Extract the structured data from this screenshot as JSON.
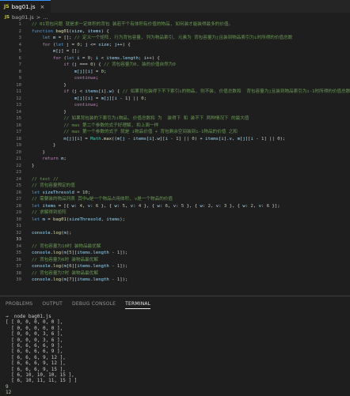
{
  "tab": {
    "icon": "JS",
    "label": "bag01.js",
    "close": "×"
  },
  "breadcrumb": {
    "icon": "JS",
    "file": "bag01.js",
    "separator": ">",
    "symbol": "..."
  },
  "colors": {
    "comment": "#6a9955",
    "keyword": "#569cd6",
    "control": "#c586c0",
    "function": "#dcdcaa",
    "variable": "#9cdcfe",
    "number": "#b5cea8",
    "string": "#ce9178",
    "plain": "#d4d4d4",
    "class": "#4ec9b0"
  },
  "code_lines": [
    {
      "n": "1",
      "tokens": [
        [
          "// 01背包问题 就是求一定体积的背包 装若干个有体积有价值的物品, 如何装才能装得最多的价值。",
          "comment"
        ]
      ]
    },
    {
      "n": "2",
      "tokens": [
        [
          "function ",
          "keyword"
        ],
        [
          "bag01",
          "function"
        ],
        [
          "(",
          "plain"
        ],
        [
          "size",
          "variable"
        ],
        [
          ", ",
          "plain"
        ],
        [
          "items",
          "variable"
        ],
        [
          ") {",
          "plain"
        ]
      ]
    },
    {
      "n": "3",
      "tokens": [
        [
          "    ",
          "plain"
        ],
        [
          "let ",
          "keyword"
        ],
        [
          "m",
          "variable"
        ],
        [
          " = []; ",
          "plain"
        ],
        [
          "// 定义一个矩阵, 行为背包容量, 列为物品索引, 元素为 背包容量为j且装到物品索引为i时所得的价值总数",
          "comment"
        ]
      ]
    },
    {
      "n": "4",
      "tokens": [
        [
          "    ",
          "plain"
        ],
        [
          "for ",
          "control"
        ],
        [
          "(",
          "plain"
        ],
        [
          "let ",
          "keyword"
        ],
        [
          "j",
          "variable"
        ],
        [
          " = ",
          "plain"
        ],
        [
          "0",
          "number"
        ],
        [
          "; ",
          "plain"
        ],
        [
          "j",
          "variable"
        ],
        [
          " <= ",
          "plain"
        ],
        [
          "size",
          "variable"
        ],
        [
          "; ",
          "plain"
        ],
        [
          "j",
          "variable"
        ],
        [
          "++) {",
          "plain"
        ]
      ]
    },
    {
      "n": "5",
      "tokens": [
        [
          "        ",
          "plain"
        ],
        [
          "m",
          "variable"
        ],
        [
          "[",
          "plain"
        ],
        [
          "j",
          "variable"
        ],
        [
          "] = [];",
          "plain"
        ]
      ]
    },
    {
      "n": "6",
      "tokens": [
        [
          "        ",
          "plain"
        ],
        [
          "for ",
          "control"
        ],
        [
          "(",
          "plain"
        ],
        [
          "let ",
          "keyword"
        ],
        [
          "i",
          "variable"
        ],
        [
          " = ",
          "plain"
        ],
        [
          "0",
          "number"
        ],
        [
          "; ",
          "plain"
        ],
        [
          "i",
          "variable"
        ],
        [
          " < ",
          "plain"
        ],
        [
          "items",
          "variable"
        ],
        [
          ".",
          "plain"
        ],
        [
          "length",
          "variable"
        ],
        [
          "; ",
          "plain"
        ],
        [
          "i",
          "variable"
        ],
        [
          "++) {",
          "plain"
        ]
      ]
    },
    {
      "n": "7",
      "tokens": [
        [
          "            ",
          "plain"
        ],
        [
          "if ",
          "control"
        ],
        [
          "(",
          "plain"
        ],
        [
          "j",
          "variable"
        ],
        [
          " === ",
          "plain"
        ],
        [
          "0",
          "number"
        ],
        [
          ") { ",
          "plain"
        ],
        [
          "// 背包容量为0, 装的价值自然为0",
          "comment"
        ]
      ]
    },
    {
      "n": "8",
      "tokens": [
        [
          "                ",
          "plain"
        ],
        [
          "m",
          "variable"
        ],
        [
          "[",
          "plain"
        ],
        [
          "j",
          "variable"
        ],
        [
          "][",
          "plain"
        ],
        [
          "i",
          "variable"
        ],
        [
          "] = ",
          "plain"
        ],
        [
          "0",
          "number"
        ],
        [
          ";",
          "plain"
        ]
      ]
    },
    {
      "n": "9",
      "tokens": [
        [
          "                ",
          "plain"
        ],
        [
          "continue",
          "control"
        ],
        [
          ";",
          "plain"
        ]
      ]
    },
    {
      "n": "10",
      "tokens": [
        [
          "            }",
          "plain"
        ]
      ]
    },
    {
      "n": "11",
      "tokens": [
        [
          "            ",
          "plain"
        ],
        [
          "if ",
          "control"
        ],
        [
          "(",
          "plain"
        ],
        [
          "j",
          "variable"
        ],
        [
          " < ",
          "plain"
        ],
        [
          "items",
          "variable"
        ],
        [
          "[",
          "plain"
        ],
        [
          "i",
          "variable"
        ],
        [
          "].",
          "plain"
        ],
        [
          "w",
          "variable"
        ],
        [
          ") { ",
          "plain"
        ],
        [
          "// 如果背包装得下不下索引i的物品, 则不装, 价值总数和  背包容量为j且装到物品索引为i-1时所得的价值总数 一致",
          "comment"
        ]
      ]
    },
    {
      "n": "12",
      "tokens": [
        [
          "                ",
          "plain"
        ],
        [
          "m",
          "variable"
        ],
        [
          "[",
          "plain"
        ],
        [
          "j",
          "variable"
        ],
        [
          "][",
          "plain"
        ],
        [
          "i",
          "variable"
        ],
        [
          "] = ",
          "plain"
        ],
        [
          "m",
          "variable"
        ],
        [
          "[",
          "plain"
        ],
        [
          "j",
          "variable"
        ],
        [
          "][",
          "plain"
        ],
        [
          "i",
          "variable"
        ],
        [
          " - ",
          "plain"
        ],
        [
          "1",
          "number"
        ],
        [
          "] || ",
          "plain"
        ],
        [
          "0",
          "number"
        ],
        [
          ";",
          "plain"
        ]
      ]
    },
    {
      "n": "13",
      "tokens": [
        [
          "                ",
          "plain"
        ],
        [
          "continue",
          "control"
        ],
        [
          ";",
          "plain"
        ]
      ]
    },
    {
      "n": "14",
      "tokens": [
        [
          "            }",
          "plain"
        ]
      ]
    },
    {
      "n": "15",
      "tokens": [
        [
          "            ",
          "plain"
        ],
        [
          "// 如果背包装的下索引为i物品, 价值总数和 为  装得下 和 装不下 两种情况下 的最大值",
          "comment"
        ]
      ]
    },
    {
      "n": "16",
      "tokens": [
        [
          "            ",
          "plain"
        ],
        [
          "// max 第二个参数的式子好理解, 和上面一样",
          "comment"
        ]
      ]
    },
    {
      "n": "17",
      "tokens": [
        [
          "            ",
          "plain"
        ],
        [
          "// max 第一个参数的式子 就是 i物品价值 + 背包剩余空间装到i-1物品的价值 之和",
          "comment"
        ]
      ]
    },
    {
      "n": "18",
      "tokens": [
        [
          "            ",
          "plain"
        ],
        [
          "m",
          "variable"
        ],
        [
          "[",
          "plain"
        ],
        [
          "j",
          "variable"
        ],
        [
          "][",
          "plain"
        ],
        [
          "i",
          "variable"
        ],
        [
          "] = ",
          "plain"
        ],
        [
          "Math",
          "class"
        ],
        [
          ".",
          "plain"
        ],
        [
          "max",
          "function"
        ],
        [
          "((",
          "plain"
        ],
        [
          "m",
          "variable"
        ],
        [
          "[",
          "plain"
        ],
        [
          "j",
          "variable"
        ],
        [
          " - ",
          "plain"
        ],
        [
          "items",
          "variable"
        ],
        [
          "[",
          "plain"
        ],
        [
          "i",
          "variable"
        ],
        [
          "].",
          "plain"
        ],
        [
          "w",
          "variable"
        ],
        [
          "][",
          "plain"
        ],
        [
          "i",
          "variable"
        ],
        [
          " - ",
          "plain"
        ],
        [
          "1",
          "number"
        ],
        [
          "] || ",
          "plain"
        ],
        [
          "0",
          "number"
        ],
        [
          ") + ",
          "plain"
        ],
        [
          "items",
          "variable"
        ],
        [
          "[",
          "plain"
        ],
        [
          "i",
          "variable"
        ],
        [
          "].",
          "plain"
        ],
        [
          "v",
          "variable"
        ],
        [
          ", ",
          "plain"
        ],
        [
          "m",
          "variable"
        ],
        [
          "[",
          "plain"
        ],
        [
          "j",
          "variable"
        ],
        [
          "][",
          "plain"
        ],
        [
          "i",
          "variable"
        ],
        [
          " - ",
          "plain"
        ],
        [
          "1",
          "number"
        ],
        [
          "] || ",
          "plain"
        ],
        [
          "0",
          "number"
        ],
        [
          ");",
          "plain"
        ]
      ]
    },
    {
      "n": "19",
      "tokens": [
        [
          "        }",
          "plain"
        ]
      ]
    },
    {
      "n": "20",
      "tokens": [
        [
          "    }",
          "plain"
        ]
      ]
    },
    {
      "n": "21",
      "tokens": [
        [
          "    ",
          "plain"
        ],
        [
          "return ",
          "control"
        ],
        [
          "m",
          "variable"
        ],
        [
          ";",
          "plain"
        ]
      ]
    },
    {
      "n": "22",
      "tokens": [
        [
          "}",
          "plain"
        ]
      ]
    },
    {
      "n": "23",
      "tokens": []
    },
    {
      "n": "24",
      "tokens": [
        [
          "// test //",
          "comment"
        ]
      ]
    },
    {
      "n": "25",
      "tokens": [
        [
          "// 背包容量预定的值",
          "comment"
        ]
      ]
    },
    {
      "n": "26",
      "tokens": [
        [
          "let ",
          "keyword"
        ],
        [
          "sizeThresold",
          "variable"
        ],
        [
          " = ",
          "plain"
        ],
        [
          "10",
          "number"
        ],
        [
          ";",
          "plain"
        ]
      ]
    },
    {
      "n": "27",
      "tokens": [
        [
          "// 需要装的物品列表 其中w是一个物品占用体积, v是一个物品的价值",
          "comment"
        ]
      ]
    },
    {
      "n": "28",
      "tokens": [
        [
          "let ",
          "keyword"
        ],
        [
          "items",
          "variable"
        ],
        [
          " = [{ ",
          "plain"
        ],
        [
          "w",
          "variable"
        ],
        [
          ": ",
          "plain"
        ],
        [
          "4",
          "number"
        ],
        [
          ", ",
          "plain"
        ],
        [
          "v",
          "variable"
        ],
        [
          ": ",
          "plain"
        ],
        [
          "6",
          "number"
        ],
        [
          " }, { ",
          "plain"
        ],
        [
          "w",
          "variable"
        ],
        [
          ": ",
          "plain"
        ],
        [
          "5",
          "number"
        ],
        [
          ", ",
          "plain"
        ],
        [
          "v",
          "variable"
        ],
        [
          ": ",
          "plain"
        ],
        [
          "4",
          "number"
        ],
        [
          " }, { ",
          "plain"
        ],
        [
          "w",
          "variable"
        ],
        [
          ": ",
          "plain"
        ],
        [
          "6",
          "number"
        ],
        [
          ", ",
          "plain"
        ],
        [
          "v",
          "variable"
        ],
        [
          ": ",
          "plain"
        ],
        [
          "5",
          "number"
        ],
        [
          " }, { ",
          "plain"
        ],
        [
          "w",
          "variable"
        ],
        [
          ": ",
          "plain"
        ],
        [
          "2",
          "number"
        ],
        [
          ", ",
          "plain"
        ],
        [
          "v",
          "variable"
        ],
        [
          ": ",
          "plain"
        ],
        [
          "3",
          "number"
        ],
        [
          " }, { ",
          "plain"
        ],
        [
          "w",
          "variable"
        ],
        [
          ": ",
          "plain"
        ],
        [
          "2",
          "number"
        ],
        [
          ", ",
          "plain"
        ],
        [
          "v",
          "variable"
        ],
        [
          ": ",
          "plain"
        ],
        [
          "6",
          "number"
        ],
        [
          " }];",
          "plain"
        ]
      ]
    },
    {
      "n": "29",
      "tokens": [
        [
          "// 求解得到矩阵",
          "comment"
        ]
      ]
    },
    {
      "n": "30",
      "tokens": [
        [
          "let ",
          "keyword"
        ],
        [
          "m",
          "variable"
        ],
        [
          " = ",
          "plain"
        ],
        [
          "bag01",
          "function"
        ],
        [
          "(",
          "plain"
        ],
        [
          "sizeThresold",
          "variable"
        ],
        [
          ", ",
          "plain"
        ],
        [
          "items",
          "variable"
        ],
        [
          ");",
          "plain"
        ]
      ]
    },
    {
      "n": "31",
      "tokens": []
    },
    {
      "n": "32",
      "tokens": [
        [
          "console",
          "variable"
        ],
        [
          ".",
          "plain"
        ],
        [
          "log",
          "function"
        ],
        [
          "(",
          "plain"
        ],
        [
          "m",
          "variable"
        ],
        [
          ");",
          "plain"
        ]
      ]
    },
    {
      "n": "33",
      "tokens": []
    },
    {
      "n": "34",
      "tokens": [
        [
          "// 背包容量为10时 装物品最优解",
          "comment"
        ]
      ]
    },
    {
      "n": "35",
      "tokens": [
        [
          "console",
          "variable"
        ],
        [
          ".",
          "plain"
        ],
        [
          "log",
          "function"
        ],
        [
          "(",
          "plain"
        ],
        [
          "m",
          "variable"
        ],
        [
          "[",
          "plain"
        ],
        [
          "5",
          "number"
        ],
        [
          "][",
          "plain"
        ],
        [
          "items",
          "variable"
        ],
        [
          ".",
          "plain"
        ],
        [
          "length",
          "variable"
        ],
        [
          " - ",
          "plain"
        ],
        [
          "1",
          "number"
        ],
        [
          "]);",
          "plain"
        ]
      ]
    },
    {
      "n": "36",
      "tokens": [
        [
          "// 背包容量为6时 装物品最优解",
          "comment"
        ]
      ]
    },
    {
      "n": "37",
      "tokens": [
        [
          "console",
          "variable"
        ],
        [
          ".",
          "plain"
        ],
        [
          "log",
          "function"
        ],
        [
          "(",
          "plain"
        ],
        [
          "m",
          "variable"
        ],
        [
          "[",
          "plain"
        ],
        [
          "6",
          "number"
        ],
        [
          "][",
          "plain"
        ],
        [
          "items",
          "variable"
        ],
        [
          ".",
          "plain"
        ],
        [
          "length",
          "variable"
        ],
        [
          " - ",
          "plain"
        ],
        [
          "1",
          "number"
        ],
        [
          "]);",
          "plain"
        ]
      ]
    },
    {
      "n": "38",
      "tokens": [
        [
          "// 背包容量为7时 装物品最优解",
          "comment"
        ]
      ]
    },
    {
      "n": "39",
      "tokens": [
        [
          "console",
          "variable"
        ],
        [
          ".",
          "plain"
        ],
        [
          "log",
          "function"
        ],
        [
          "(",
          "plain"
        ],
        [
          "m",
          "variable"
        ],
        [
          "[",
          "plain"
        ],
        [
          "7",
          "number"
        ],
        [
          "][",
          "plain"
        ],
        [
          "items",
          "variable"
        ],
        [
          ".",
          "plain"
        ],
        [
          "length",
          "variable"
        ],
        [
          " - ",
          "plain"
        ],
        [
          "1",
          "number"
        ],
        [
          "]);",
          "plain"
        ]
      ]
    }
  ],
  "panel": {
    "tabs": [
      "PROBLEMS",
      "OUTPUT",
      "DEBUG CONSOLE",
      "TERMINAL"
    ],
    "active": 3
  },
  "terminal": [
    "→  node bag01.js",
    "[ [ 0, 0, 0, 0, 0 ],",
    "  [ 0, 0, 0, 0, 0 ],",
    "  [ 0, 0, 0, 3, 6 ],",
    "  [ 0, 0, 0, 3, 6 ],",
    "  [ 6, 6, 6, 6, 9 ],",
    "  [ 6, 6, 6, 6, 9 ],",
    "  [ 6, 6, 6, 9, 12 ],",
    "  [ 6, 6, 6, 9, 12 ],",
    "  [ 6, 6, 6, 9, 15 ],",
    "  [ 6, 10, 10, 10, 15 ],",
    "  [ 6, 10, 11, 11, 15 ] ]",
    "9",
    "12",
    "12"
  ]
}
